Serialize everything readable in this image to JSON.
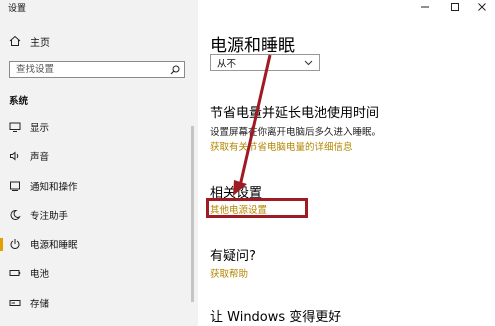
{
  "window": {
    "app_title": "设置"
  },
  "sidebar": {
    "home_label": "主页",
    "search_placeholder": "查找设置",
    "section_title": "系统",
    "items": [
      {
        "label": "显示",
        "icon": "monitor-icon"
      },
      {
        "label": "声音",
        "icon": "speaker-icon"
      },
      {
        "label": "通知和操作",
        "icon": "notification-icon"
      },
      {
        "label": "专注助手",
        "icon": "moon-icon"
      },
      {
        "label": "电源和睡眠",
        "icon": "power-icon",
        "active": true
      },
      {
        "label": "电池",
        "icon": "battery-icon"
      },
      {
        "label": "存储",
        "icon": "storage-icon"
      }
    ]
  },
  "main": {
    "page_title": "电源和睡眠",
    "sleep_select_value": "从不",
    "battery_section": {
      "heading": "节省电量并延长电池使用时间",
      "description": "设置屏幕在你离开电脑后多久进入睡眠。",
      "link": "获取有关节省电脑电量的详细信息"
    },
    "related_section": {
      "heading": "相关设置",
      "link": "其他电源设置"
    },
    "question_section": {
      "heading": "有疑问?",
      "link": "获取帮助"
    },
    "improve_section": {
      "heading": "让 Windows 变得更好"
    }
  },
  "colors": {
    "accent_link": "#b38600",
    "active_indicator": "#e0a000",
    "annotation_red": "#a01a24"
  }
}
